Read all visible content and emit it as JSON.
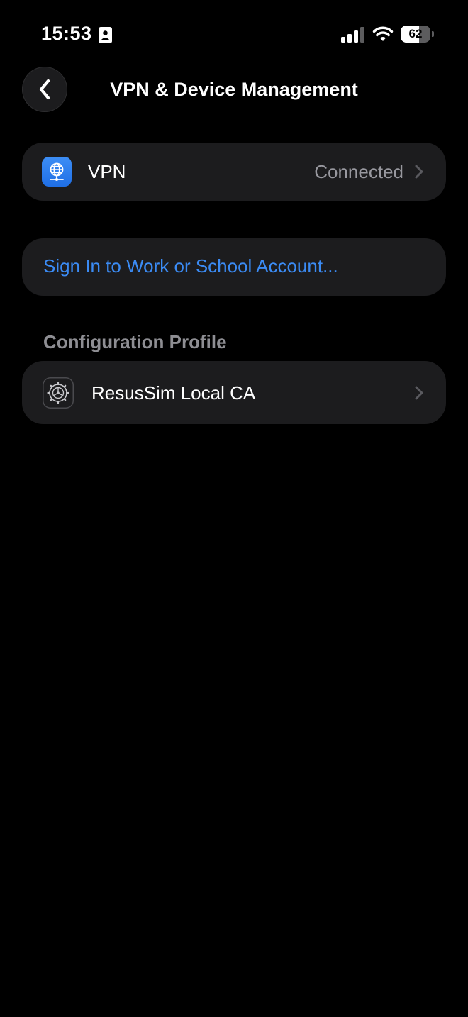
{
  "status_bar": {
    "time": "15:53",
    "battery_percent": "62",
    "battery_level": 0.62,
    "signal_bars": 3,
    "icons": [
      "id-card-icon",
      "cellular-signal-icon",
      "wifi-icon",
      "battery-icon"
    ]
  },
  "nav": {
    "title": "VPN & Device Management",
    "back_icon": "chevron-left-icon"
  },
  "vpn_row": {
    "label": "VPN",
    "value": "Connected",
    "icon": "vpn-globe-icon",
    "icon_color": "#2f80ed"
  },
  "signin_row": {
    "label": "Sign In to Work or School Account..."
  },
  "configuration_section": {
    "header": "Configuration Profile",
    "items": [
      {
        "label": "ResusSim Local CA",
        "icon": "settings-gear-icon"
      }
    ]
  },
  "colors": {
    "background": "#000000",
    "group_background": "#1c1c1e",
    "link": "#3b8bf4",
    "secondary_text": "#98989f",
    "section_header": "#8e8e93"
  }
}
